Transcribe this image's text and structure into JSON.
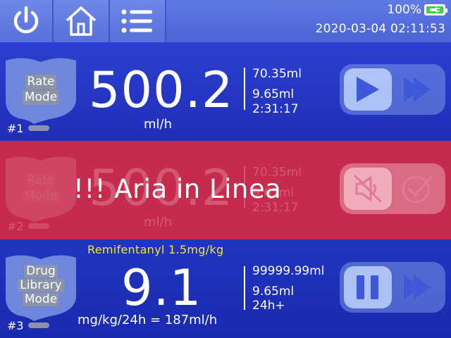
{
  "topbar": {
    "buttons": [
      {
        "name": "power",
        "icon": "power-icon"
      },
      {
        "name": "home",
        "icon": "home-icon"
      },
      {
        "name": "menu",
        "icon": "list-menu-icon"
      }
    ],
    "battery_percent": "100%",
    "battery_level": 1.0,
    "battery_charging": true,
    "datetime": "2020-03-04 02:11:53"
  },
  "channels": [
    {
      "number": "#1",
      "mode_lines": [
        "Rate",
        "Mode"
      ],
      "rate": "500.2",
      "unit": "ml/h",
      "stat1": "70.35ml",
      "stat2": "9.65ml",
      "stat3": "2:31:17",
      "controls": [
        "play-icon",
        "fast-forward-icon"
      ]
    },
    {
      "number": "#2",
      "mode_lines": [
        "Rate",
        "Mode"
      ],
      "rate": "500.2",
      "unit": "ml/h",
      "stat1": "70.35ml",
      "stat2": "9.65ml",
      "stat3": "2:31:17",
      "alarm": "!!! Aria in Linea",
      "controls": [
        "mute-icon",
        "check-icon"
      ]
    },
    {
      "number": "#3",
      "mode_lines": [
        "Drug",
        "Library",
        "Mode"
      ],
      "drug": "Remifentanyl  1.5mg/kg",
      "rate": "9.1",
      "unit": "mg/kg/24h = 187ml/h",
      "stat1": "99999.99ml",
      "stat2": "9.65ml",
      "stat3": "24h+",
      "controls": [
        "pause-icon",
        "fast-forward-icon"
      ]
    }
  ],
  "colors": {
    "topbar": "#4a63d6",
    "channel_bg": "#2035bf",
    "alarm_bg": "#c62a4d",
    "drug_name": "#f5e43b",
    "battery_fill": "#3ad04a"
  }
}
